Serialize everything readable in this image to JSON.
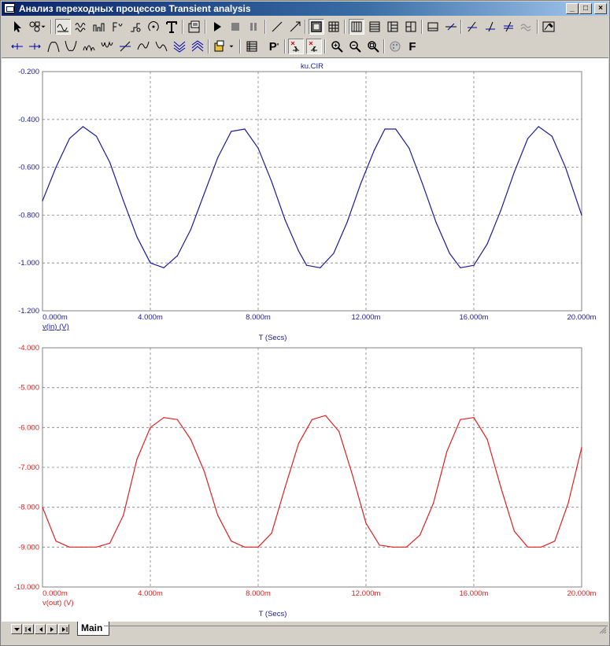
{
  "window": {
    "title": "Анализ переходных процессов Transient analysis",
    "controls": [
      "_",
      "□",
      "×"
    ]
  },
  "toolbar1": {
    "buttons": [
      "select-pointer",
      "annotate",
      "waveform",
      "spectrum",
      "histogram",
      "eye-pattern",
      "smith",
      "polar",
      "text",
      "properties",
      "run",
      "stop",
      "pause",
      "line-tool",
      "arrow-tool",
      "frame",
      "grid",
      "layout-1",
      "layout-2",
      "layout-3",
      "layout-4",
      "horiz-line",
      "cursor-cross",
      "probe-1",
      "probe-2",
      "probe-3",
      "probe-4",
      "export"
    ]
  },
  "toolbar2": {
    "buttons": [
      "cursor-left",
      "cursor-right",
      "peak",
      "valley",
      "high",
      "low",
      "slope-up",
      "slope-down",
      "inflection",
      "global-high",
      "global-low",
      "tag",
      "data-table",
      "format-P",
      "markers-1",
      "markers-2",
      "zoom-in",
      "zoom-out",
      "zoom-fit",
      "color",
      "font-F"
    ],
    "format_label": "P",
    "font_label": "F"
  },
  "status": {
    "sheet_tab": "Main"
  },
  "chart_data": [
    {
      "type": "line",
      "title": "ku.CIR",
      "xlabel": "T (Secs)",
      "ylabel": "",
      "xlim": [
        0,
        0.02
      ],
      "ylim": [
        -1.2,
        -0.2
      ],
      "x_ticks": [
        "0.000m",
        "4.000m",
        "8.000m",
        "12.000m",
        "16.000m",
        "20.000m"
      ],
      "y_ticks": [
        "-0.200",
        "-0.400",
        "-0.600",
        "-0.800",
        "-1.000",
        "-1.200"
      ],
      "grid": true,
      "series": [
        {
          "name": "v(in) (V)",
          "color": "#1a1aa0",
          "points": [
            [
              0,
              -0.74
            ],
            [
              0.0005,
              -0.6
            ],
            [
              0.001,
              -0.48
            ],
            [
              0.0015,
              -0.43
            ],
            [
              0.002,
              -0.47
            ],
            [
              0.0025,
              -0.58
            ],
            [
              0.003,
              -0.74
            ],
            [
              0.0035,
              -0.89
            ],
            [
              0.004,
              -1.0
            ],
            [
              0.0045,
              -1.02
            ],
            [
              0.005,
              -0.97
            ],
            [
              0.0055,
              -0.86
            ],
            [
              0.006,
              -0.71
            ],
            [
              0.0065,
              -0.56
            ],
            [
              0.007,
              -0.45
            ],
            [
              0.0075,
              -0.44
            ],
            [
              0.008,
              -0.52
            ],
            [
              0.0085,
              -0.66
            ],
            [
              0.009,
              -0.82
            ],
            [
              0.0095,
              -0.95
            ],
            [
              0.0098,
              -1.01
            ],
            [
              0.0103,
              -1.02
            ],
            [
              0.0108,
              -0.96
            ],
            [
              0.0113,
              -0.83
            ],
            [
              0.0118,
              -0.67
            ],
            [
              0.0123,
              -0.53
            ],
            [
              0.0127,
              -0.44
            ],
            [
              0.0131,
              -0.44
            ],
            [
              0.0136,
              -0.52
            ],
            [
              0.0141,
              -0.67
            ],
            [
              0.0146,
              -0.83
            ],
            [
              0.0151,
              -0.96
            ],
            [
              0.0155,
              -1.02
            ],
            [
              0.016,
              -1.01
            ],
            [
              0.0165,
              -0.92
            ],
            [
              0.017,
              -0.78
            ],
            [
              0.0175,
              -0.62
            ],
            [
              0.018,
              -0.48
            ],
            [
              0.0184,
              -0.43
            ],
            [
              0.0189,
              -0.47
            ],
            [
              0.0194,
              -0.6
            ],
            [
              0.02,
              -0.8
            ],
            [
              0.02,
              -0.8
            ]
          ]
        }
      ]
    },
    {
      "type": "line",
      "title": "",
      "xlabel": "T (Secs)",
      "ylabel": "",
      "xlim": [
        0,
        0.02
      ],
      "ylim": [
        -10,
        -4
      ],
      "x_ticks": [
        "0.000m",
        "4.000m",
        "8.000m",
        "12.000m",
        "16.000m",
        "20.000m"
      ],
      "y_ticks": [
        "-4.000",
        "-5.000",
        "-6.000",
        "-7.000",
        "-8.000",
        "-9.000",
        "-10.000"
      ],
      "grid": true,
      "series": [
        {
          "name": "v(out) (V)",
          "color": "#e02020",
          "points": [
            [
              0,
              -8.0
            ],
            [
              0.0005,
              -8.85
            ],
            [
              0.001,
              -9.0
            ],
            [
              0.002,
              -9.0
            ],
            [
              0.0025,
              -8.9
            ],
            [
              0.003,
              -8.2
            ],
            [
              0.0035,
              -6.8
            ],
            [
              0.004,
              -6.0
            ],
            [
              0.0045,
              -5.75
            ],
            [
              0.005,
              -5.8
            ],
            [
              0.0055,
              -6.3
            ],
            [
              0.006,
              -7.1
            ],
            [
              0.0065,
              -8.2
            ],
            [
              0.007,
              -8.85
            ],
            [
              0.0075,
              -9.0
            ],
            [
              0.008,
              -9.0
            ],
            [
              0.0085,
              -8.65
            ],
            [
              0.009,
              -7.5
            ],
            [
              0.0095,
              -6.4
            ],
            [
              0.01,
              -5.8
            ],
            [
              0.0105,
              -5.7
            ],
            [
              0.011,
              -6.1
            ],
            [
              0.0115,
              -7.2
            ],
            [
              0.012,
              -8.4
            ],
            [
              0.0125,
              -8.95
            ],
            [
              0.013,
              -9.0
            ],
            [
              0.0135,
              -9.0
            ],
            [
              0.014,
              -8.7
            ],
            [
              0.0145,
              -7.9
            ],
            [
              0.015,
              -6.6
            ],
            [
              0.0155,
              -5.8
            ],
            [
              0.016,
              -5.75
            ],
            [
              0.0165,
              -6.3
            ],
            [
              0.017,
              -7.5
            ],
            [
              0.0175,
              -8.6
            ],
            [
              0.018,
              -9.0
            ],
            [
              0.0185,
              -9.0
            ],
            [
              0.019,
              -8.85
            ],
            [
              0.0195,
              -7.9
            ],
            [
              0.02,
              -6.5
            ]
          ]
        }
      ]
    }
  ]
}
